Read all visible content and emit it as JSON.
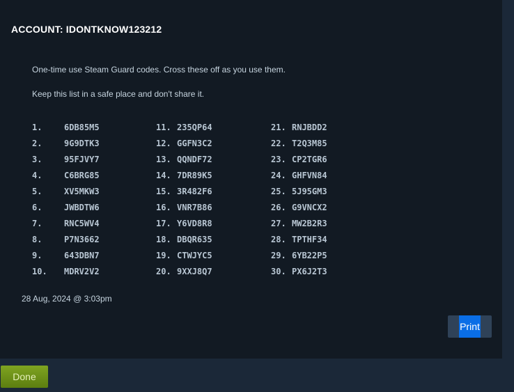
{
  "dialog": {
    "account_title": "ACCOUNT: IDONTKNOW123212",
    "instruction_1": "One-time use Steam Guard codes. Cross these off as you use them.",
    "instruction_2": "Keep this list in a safe place and don't share it.",
    "date": "28 Aug, 2024 @ 3:03pm",
    "print_label": "Print"
  },
  "codes": {
    "columns": [
      [
        {
          "num": "1.",
          "code": "6DB85M5"
        },
        {
          "num": "2.",
          "code": "9G9DTK3"
        },
        {
          "num": "3.",
          "code": "95FJVY7"
        },
        {
          "num": "4.",
          "code": "C6BRG85"
        },
        {
          "num": "5.",
          "code": "XV5MKW3"
        },
        {
          "num": "6.",
          "code": "JWBDTW6"
        },
        {
          "num": "7.",
          "code": "RNC5WV4"
        },
        {
          "num": "8.",
          "code": "P7N3662"
        },
        {
          "num": "9.",
          "code": "643DBN7"
        },
        {
          "num": "10.",
          "code": "MDRV2V2"
        }
      ],
      [
        {
          "num": "11.",
          "code": "235QP64"
        },
        {
          "num": "12.",
          "code": "GGFN3C2"
        },
        {
          "num": "13.",
          "code": "QQNDF72"
        },
        {
          "num": "14.",
          "code": "7DR89K5"
        },
        {
          "num": "15.",
          "code": "3R482F6"
        },
        {
          "num": "16.",
          "code": "VNR7B86"
        },
        {
          "num": "17.",
          "code": "Y6VD8R8"
        },
        {
          "num": "18.",
          "code": "DBQR635"
        },
        {
          "num": "19.",
          "code": "CTWJYC5"
        },
        {
          "num": "20.",
          "code": "9XXJ8Q7"
        }
      ],
      [
        {
          "num": "21.",
          "code": "RNJBDD2"
        },
        {
          "num": "22.",
          "code": "T2Q3M85"
        },
        {
          "num": "23.",
          "code": "CP2TGR6"
        },
        {
          "num": "24.",
          "code": "GHFVN84"
        },
        {
          "num": "25.",
          "code": "5J95GM3"
        },
        {
          "num": "26.",
          "code": "G9VNCX2"
        },
        {
          "num": "27.",
          "code": "MW2B2R3"
        },
        {
          "num": "28.",
          "code": "TPTHF34"
        },
        {
          "num": "29.",
          "code": "6YB22P5"
        },
        {
          "num": "30.",
          "code": "PX6J2T3"
        }
      ]
    ]
  },
  "footer": {
    "done_label": "Done"
  },
  "colors": {
    "page_background": "#1b2838",
    "panel_background": "#121a23",
    "print_highlight": "#0a6ee6",
    "done_button": "#7fa421"
  }
}
